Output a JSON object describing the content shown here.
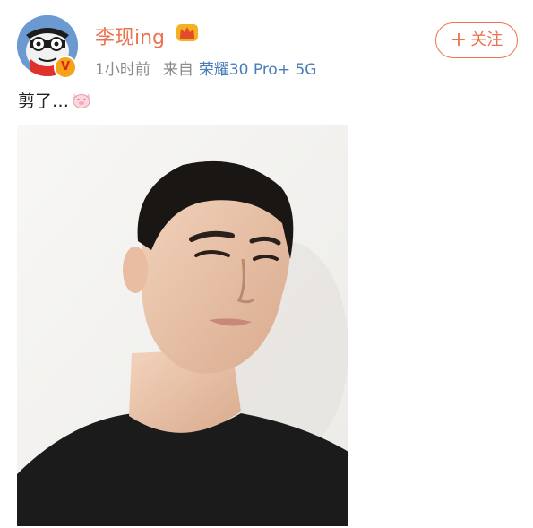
{
  "post": {
    "username": "李现ing",
    "time": "1小时前",
    "source_prefix": "来自",
    "device": "荣耀30 Pro+ 5G",
    "follow_label": "关注",
    "follow_plus": "+",
    "text": "剪了…",
    "verified_badge": "V",
    "icons": {
      "avatar": "cartoon-avatar",
      "verified": "verified-badge-icon",
      "crown": "crown-icon",
      "emoji": "pig-emoji-icon"
    },
    "colors": {
      "accent": "#eb7350",
      "link": "#4a7cb7",
      "meta": "#8a8a8a"
    }
  }
}
